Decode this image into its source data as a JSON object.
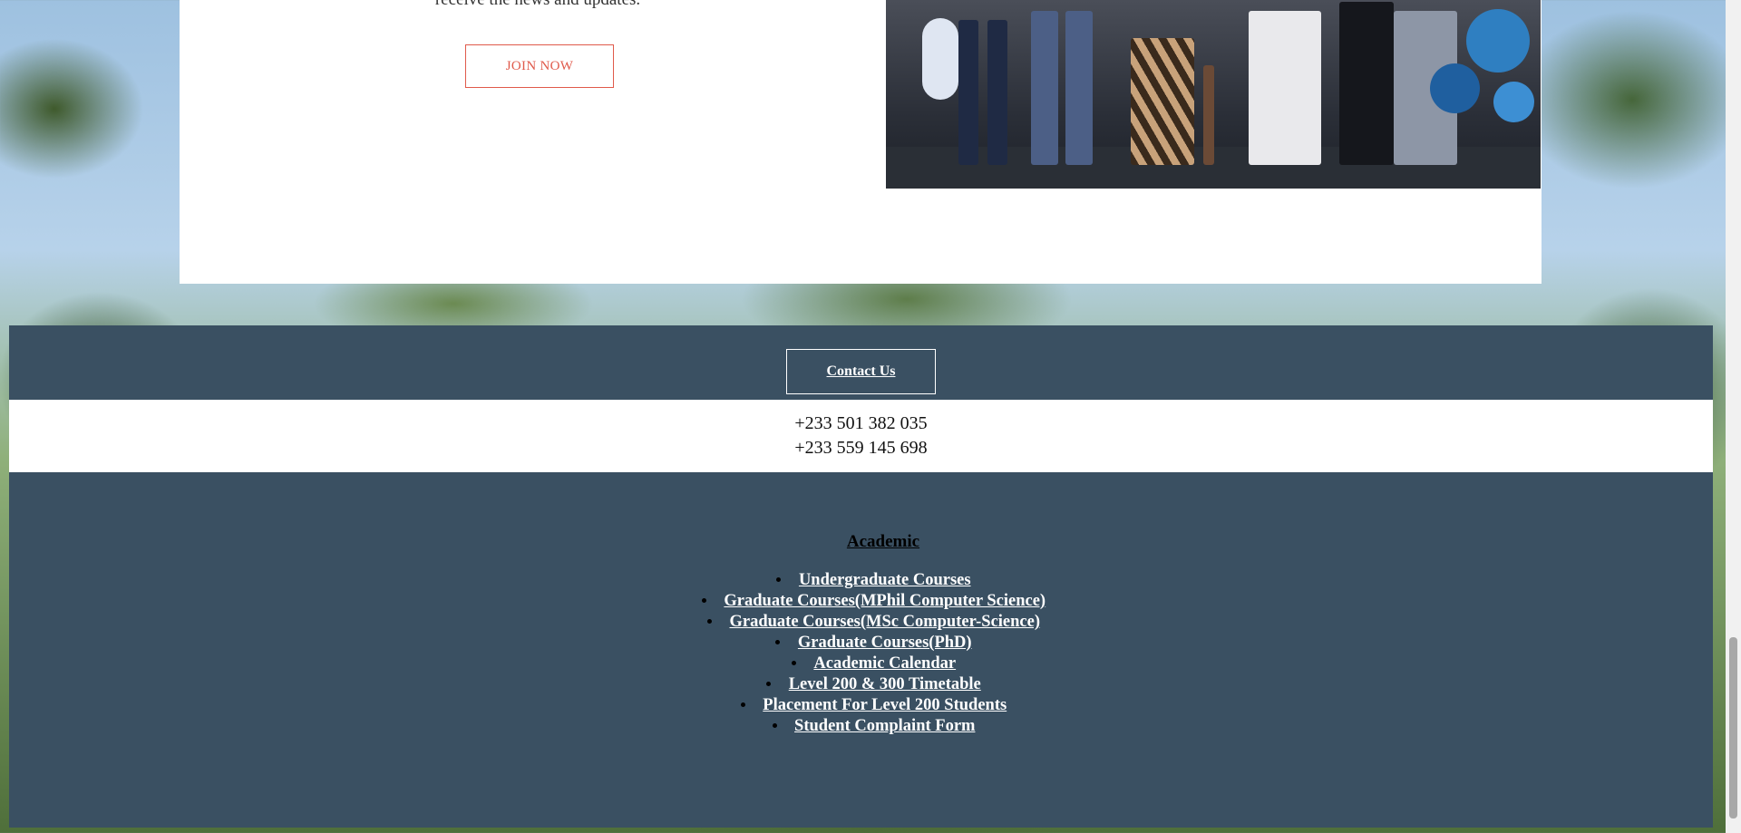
{
  "hero": {
    "partial_text": "receive the news and updates.",
    "join_label": "JOIN NOW"
  },
  "contact": {
    "button_label": "Contact Us",
    "phones": [
      "+233 501 382 035",
      "+233 559 145 698"
    ]
  },
  "academic": {
    "title": "Academic",
    "links": [
      {
        "label": "Undergraduate Courses"
      },
      {
        "label": "Graduate Courses(MPhil Computer Science)"
      },
      {
        "label": "Graduate Courses(MSc Computer-Science)"
      },
      {
        "label": "Graduate Courses(PhD)"
      },
      {
        "label": "Academic Calendar"
      },
      {
        "label": "Level 200 & 300 Timetable"
      },
      {
        "label": "Placement For Level 200 Students"
      },
      {
        "label": "Student Complaint Form"
      }
    ]
  },
  "colors": {
    "footer_bg": "#3a5062",
    "accent_red": "#e05a4b",
    "white": "#ffffff"
  }
}
